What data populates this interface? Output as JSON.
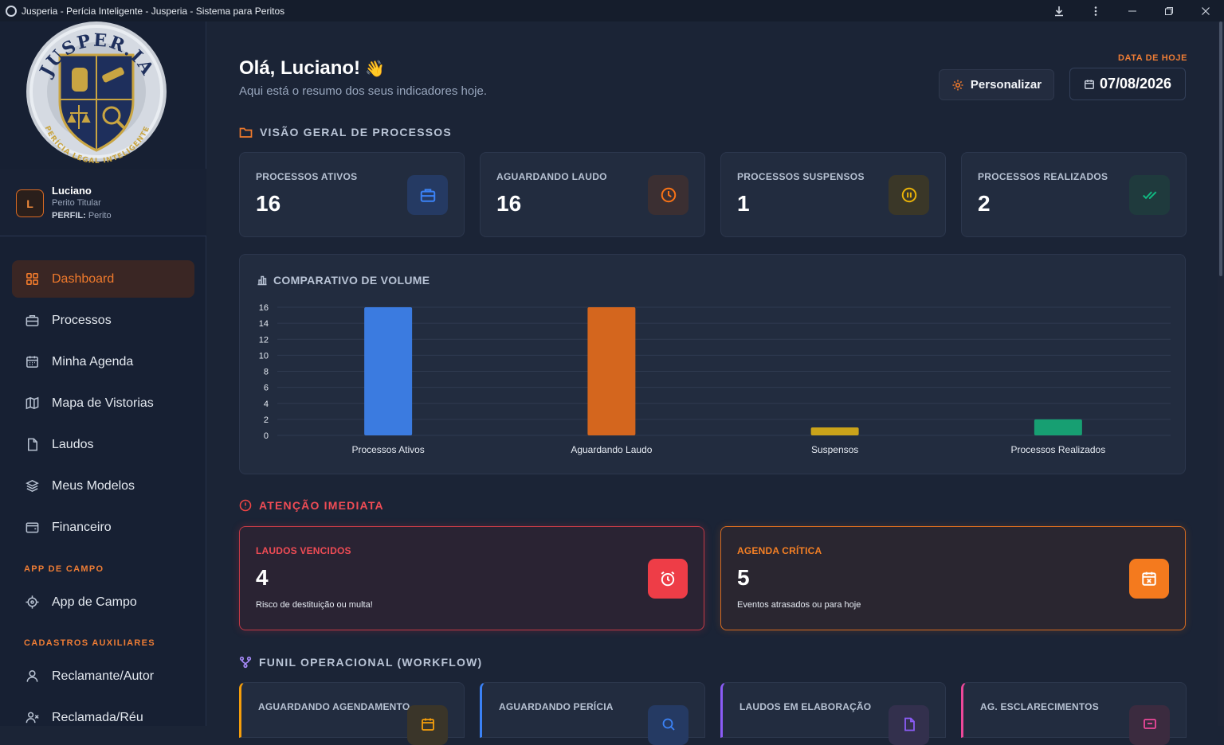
{
  "window": {
    "title": "Jusperia - Perícia Inteligente - Jusperia - Sistema para Peritos"
  },
  "logo": {
    "top_text": "JUSPER.IA",
    "bottom_text": "PERÍCIA LEGAL INTELIGENTE"
  },
  "user": {
    "initial": "L",
    "name": "Luciano",
    "role": "Perito Titular",
    "profile_label": "PERFIL:",
    "profile_value": "Perito"
  },
  "nav": {
    "items": [
      {
        "label": "Dashboard",
        "icon": "grid-icon",
        "active": true
      },
      {
        "label": "Processos",
        "icon": "briefcase-icon"
      },
      {
        "label": "Minha Agenda",
        "icon": "calendar-icon"
      },
      {
        "label": "Mapa de Vistorias",
        "icon": "map-icon"
      },
      {
        "label": "Laudos",
        "icon": "document-icon"
      },
      {
        "label": "Meus Modelos",
        "icon": "layers-icon"
      },
      {
        "label": "Financeiro",
        "icon": "wallet-icon"
      }
    ],
    "section_field": "APP DE CAMPO",
    "field_items": [
      {
        "label": "App de Campo",
        "icon": "target-icon"
      }
    ],
    "section_aux": "CADASTROS AUXILIARES",
    "aux_items": [
      {
        "label": "Reclamante/Autor",
        "icon": "user-icon"
      },
      {
        "label": "Reclamada/Réu",
        "icon": "user-x-icon"
      }
    ]
  },
  "header": {
    "greeting": "Olá, Luciano!",
    "greeting_emoji": "👋",
    "subtitle": "Aqui está o resumo dos seus indicadores hoje.",
    "customize_label": "Personalizar",
    "date_label": "DATA DE HOJE",
    "date_value": "07/08/2026"
  },
  "overview": {
    "title": "VISÃO GERAL DE PROCESSOS",
    "cards": [
      {
        "label": "PROCESSOS ATIVOS",
        "value": "16",
        "icon": "briefcase-icon",
        "color": "#3b82f6"
      },
      {
        "label": "AGUARDANDO LAUDO",
        "value": "16",
        "icon": "clock-icon",
        "color": "#f97316"
      },
      {
        "label": "PROCESSOS SUSPENSOS",
        "value": "1",
        "icon": "pause-icon",
        "color": "#eab308"
      },
      {
        "label": "PROCESSOS REALIZADOS",
        "value": "2",
        "icon": "double-check-icon",
        "color": "#10b981"
      }
    ]
  },
  "chart_data": {
    "type": "bar",
    "title": "COMPARATIVO DE VOLUME",
    "categories": [
      "Processos Ativos",
      "Aguardando Laudo",
      "Suspensos",
      "Processos Realizados"
    ],
    "values": [
      16,
      16,
      1,
      2
    ],
    "colors": [
      "#3b7be0",
      "#d4661e",
      "#caa31a",
      "#179f72"
    ],
    "ylim": [
      0,
      16
    ],
    "yticks": [
      0,
      2,
      4,
      6,
      8,
      10,
      12,
      14,
      16
    ],
    "grid": true,
    "legend": "none"
  },
  "attention": {
    "title": "ATENÇÃO IMEDIATA",
    "cards": [
      {
        "label": "LAUDOS VENCIDOS",
        "value": "4",
        "desc": "Risco de destituição ou multa!",
        "icon": "alarm-icon",
        "color": "#ee3d47"
      },
      {
        "label": "AGENDA CRÍTICA",
        "value": "5",
        "desc": "Eventos atrasados ou para hoje",
        "icon": "calendar-x-icon",
        "color": "#f47a1e"
      }
    ]
  },
  "workflow": {
    "title": "FUNIL OPERACIONAL (WORKFLOW)",
    "cards": [
      {
        "label": "AGUARDANDO AGENDAMENTO",
        "icon": "calendar-icon",
        "color": "#f59e0b"
      },
      {
        "label": "AGUARDANDO PERÍCIA",
        "icon": "search-icon",
        "color": "#3b82f6"
      },
      {
        "label": "LAUDOS EM ELABORAÇÃO",
        "icon": "document-icon",
        "color": "#8b5cf6"
      },
      {
        "label": "AG. ESCLARECIMENTOS",
        "icon": "message-icon",
        "color": "#ec4899"
      }
    ]
  }
}
